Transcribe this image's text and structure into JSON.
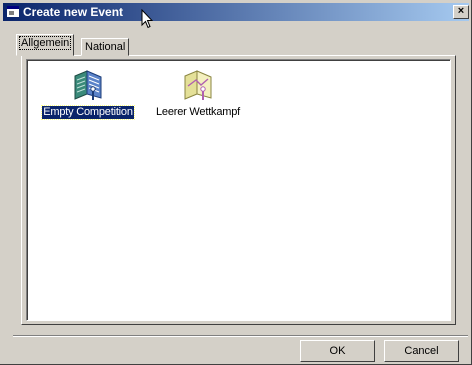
{
  "window": {
    "title": "Create new Event",
    "close_label": "×"
  },
  "tabs": [
    {
      "label": "Allgemein",
      "active": true
    },
    {
      "label": "National",
      "active": false
    }
  ],
  "items": [
    {
      "label": "Empty Competition",
      "icon": "empty-competition-icon",
      "selected": true
    },
    {
      "label": "Leerer Wettkampf",
      "icon": "leerer-wettkampf-icon",
      "selected": false
    }
  ],
  "buttons": {
    "ok": "OK",
    "cancel": "Cancel"
  },
  "colors": {
    "titlebar_start": "#0a246a",
    "titlebar_end": "#a6caf0",
    "face": "#d4d0c8",
    "selection": "#0a246a"
  }
}
